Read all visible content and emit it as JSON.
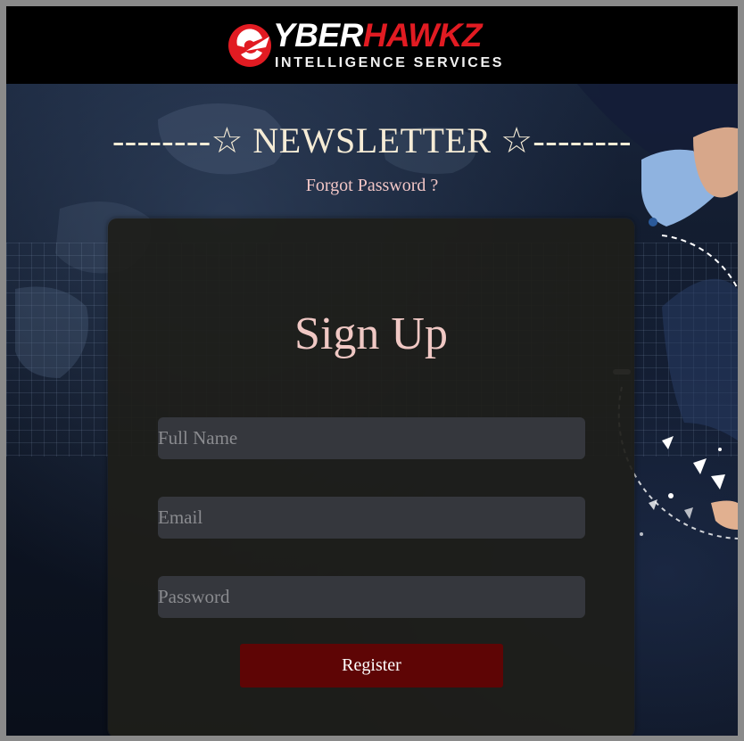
{
  "brand": {
    "name_part1": "YBER",
    "name_part2": "HAWKZ",
    "tagline": "INTELLIGENCE SERVICES",
    "colors": {
      "red": "#e11b22",
      "white": "#ffffff"
    }
  },
  "newsletter": {
    "title": "--------☆ NEWSLETTER ☆--------",
    "forgot_link": "Forgot Password ?"
  },
  "form": {
    "title": "Sign Up",
    "full_name_placeholder": "Full Name",
    "email_placeholder": "Email",
    "password_placeholder": "Password",
    "submit_label": "Register"
  },
  "colors": {
    "card_bg": "#1e1e1a",
    "input_bg": "#35373d",
    "button_bg": "#5e0505",
    "title_color": "#f0c8c4",
    "newsletter_color": "#f6ecd6"
  }
}
